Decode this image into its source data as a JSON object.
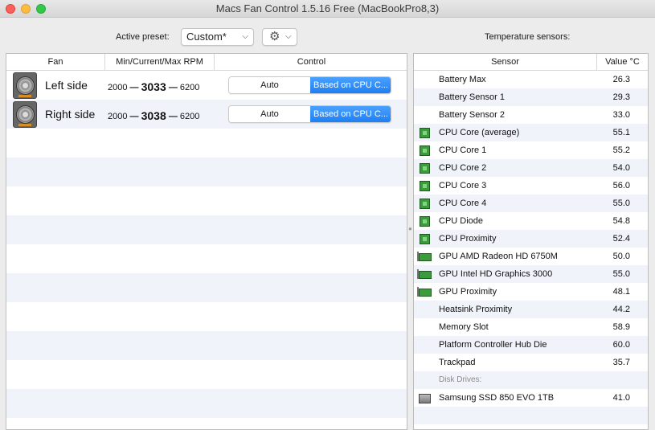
{
  "window": {
    "title": "Macs Fan Control 1.5.16 Free (MacBookPro8,3)"
  },
  "toolbar": {
    "active_preset_label": "Active preset:",
    "preset_value": "Custom*",
    "preset_chevron_icon": "chevron-down-icon",
    "gear_icon": "gear-icon",
    "sensors_label": "Temperature sensors:"
  },
  "fans": {
    "headers": {
      "fan": "Fan",
      "rpm": "Min/Current/Max RPM",
      "control": "Control"
    },
    "rows": [
      {
        "name": "Left side",
        "min": "2000",
        "dash": "—",
        "current": "3033",
        "max": "6200",
        "auto_label": "Auto",
        "cpu_label": "Based on CPU C...",
        "selected": "cpu"
      },
      {
        "name": "Right side",
        "min": "2000",
        "dash": "—",
        "current": "3038",
        "max": "6200",
        "auto_label": "Auto",
        "cpu_label": "Based on CPU C...",
        "selected": "cpu"
      }
    ]
  },
  "sensors": {
    "headers": {
      "sensor": "Sensor",
      "value": "Value °C"
    },
    "rows": [
      {
        "icon": "none",
        "name": "Battery Max",
        "value": "26.3"
      },
      {
        "icon": "none",
        "name": "Battery Sensor 1",
        "value": "29.3"
      },
      {
        "icon": "none",
        "name": "Battery Sensor 2",
        "value": "33.0"
      },
      {
        "icon": "cpu-chip-icon",
        "name": "CPU Core (average)",
        "value": "55.1"
      },
      {
        "icon": "cpu-chip-icon",
        "name": "CPU Core 1",
        "value": "55.2"
      },
      {
        "icon": "cpu-chip-icon",
        "name": "CPU Core 2",
        "value": "54.0"
      },
      {
        "icon": "cpu-chip-icon",
        "name": "CPU Core 3",
        "value": "56.0"
      },
      {
        "icon": "cpu-chip-icon",
        "name": "CPU Core 4",
        "value": "55.0"
      },
      {
        "icon": "cpu-chip-icon",
        "name": "CPU Diode",
        "value": "54.8"
      },
      {
        "icon": "cpu-chip-icon",
        "name": "CPU Proximity",
        "value": "52.4"
      },
      {
        "icon": "gpu-card-icon",
        "name": "GPU AMD Radeon HD 6750M",
        "value": "50.0"
      },
      {
        "icon": "gpu-card-icon",
        "name": "GPU Intel HD Graphics 3000",
        "value": "55.0"
      },
      {
        "icon": "gpu-card-icon",
        "name": "GPU Proximity",
        "value": "48.1"
      },
      {
        "icon": "none",
        "name": "Heatsink Proximity",
        "value": "44.2"
      },
      {
        "icon": "none",
        "name": "Memory Slot",
        "value": "58.9"
      },
      {
        "icon": "none",
        "name": "Platform Controller Hub Die",
        "value": "60.0"
      },
      {
        "icon": "none",
        "name": "Trackpad",
        "value": "35.7"
      }
    ],
    "group_label": "Disk Drives:",
    "disk_rows": [
      {
        "icon": "ssd-drive-icon",
        "name": "Samsung SSD 850 EVO 1TB",
        "value": "41.0"
      }
    ]
  },
  "colors": {
    "accent": "#1f7ff2",
    "row_stripe": "#f0f3fa"
  }
}
